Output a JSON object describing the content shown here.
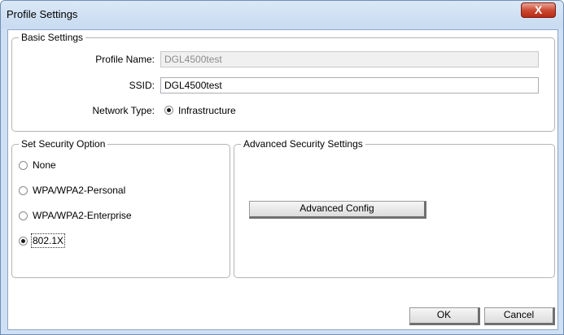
{
  "window": {
    "title": "Profile Settings",
    "close_symbol": "X"
  },
  "basic": {
    "legend": "Basic Settings",
    "profile_name_label": "Profile Name:",
    "profile_name_value": "DGL4500test",
    "ssid_label": "SSID:",
    "ssid_value": "DGL4500test",
    "network_type_label": "Network Type:",
    "network_type_option": "Infrastructure",
    "network_type_selected": true
  },
  "security": {
    "legend": "Set Security Option",
    "options": [
      {
        "label": "None",
        "selected": false
      },
      {
        "label": "WPA/WPA2-Personal",
        "selected": false
      },
      {
        "label": "WPA/WPA2-Enterprise",
        "selected": false
      },
      {
        "label": "802.1X",
        "selected": true
      }
    ]
  },
  "advanced": {
    "legend": "Advanced Security Settings",
    "config_button": "Advanced Config"
  },
  "footer": {
    "ok_label": "OK",
    "cancel_label": "Cancel"
  }
}
